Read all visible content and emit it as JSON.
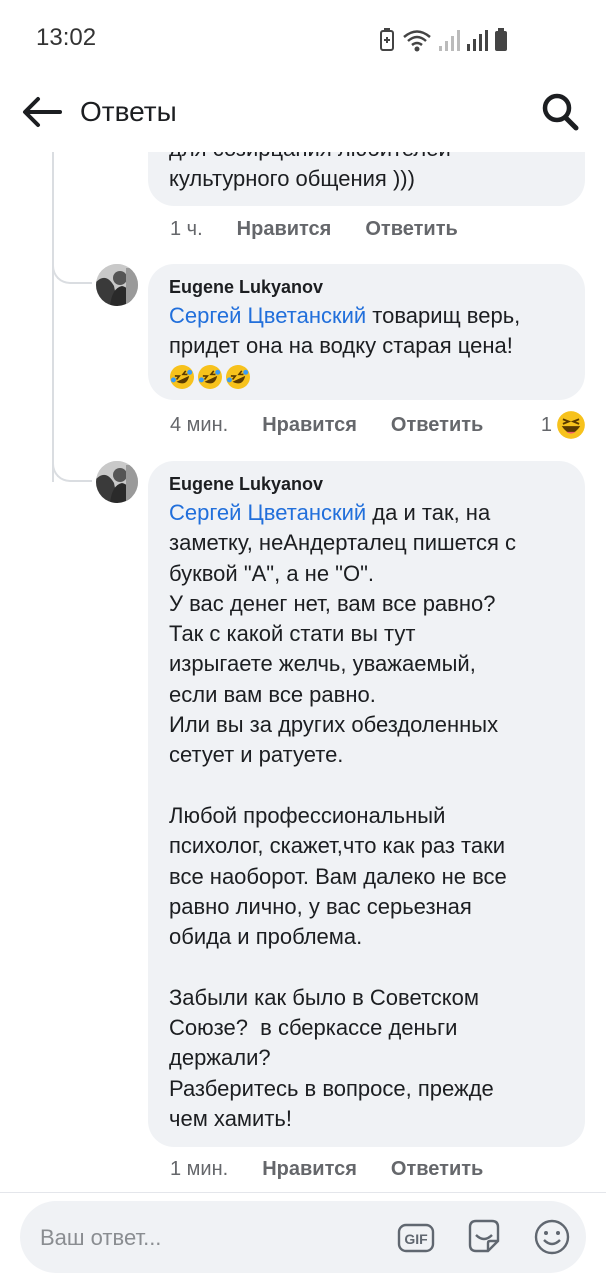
{
  "status": {
    "time": "13:02"
  },
  "appbar": {
    "title": "Ответы"
  },
  "comments": [
    {
      "text_partial": "для созирцания любителей\nкультурного общения )))",
      "time": "1 ч.",
      "like": "Нравится",
      "reply": "Ответить"
    },
    {
      "author": "Eugene Lukyanov",
      "mention": "Сергей Цветанский",
      "text": " товарищ верь,\nпридет она на водку старая цена!",
      "emojis": [
        "rofl",
        "rofl",
        "rofl"
      ],
      "time": "4 мин.",
      "like": "Нравится",
      "reply": "Ответить",
      "reaction_count": "1"
    },
    {
      "author": "Eugene Lukyanov",
      "mention": "Сергей Цветанский",
      "text": " да и так, на\nзаметку, неАндерталец пишется с\nбуквой \"А\", а не \"О\".\nУ вас денег нет, вам все равно?\nТак с какой стати вы тут\nизрыгаете желчь, уважаемый,\nесли вам все равно.\nИли вы за других обездоленных\nсетует и ратуете.\n\nЛюбой профессиональный\nпсихолог, скажет,что как раз таки\nвсе наоборот. Вам далеко не все\nравно лично, у вас серьезная\nобида и проблема.\n\nЗабыли как было в Советском\nСоюзе?  в сберкассе деньги\nдержали?\nРазберитесь в вопросе, прежде\nчем хамить!",
      "time": "1 мин.",
      "like": "Нравится",
      "reply": "Ответить"
    }
  ],
  "footer": {
    "placeholder": "Ваш ответ...",
    "gif_label": "GIF",
    "icons": [
      "gif-icon",
      "sticker-icon",
      "emoji-icon"
    ]
  },
  "colors": {
    "mention": "#216fdb",
    "bubble": "#f0f2f5",
    "meta": "#65676b"
  }
}
